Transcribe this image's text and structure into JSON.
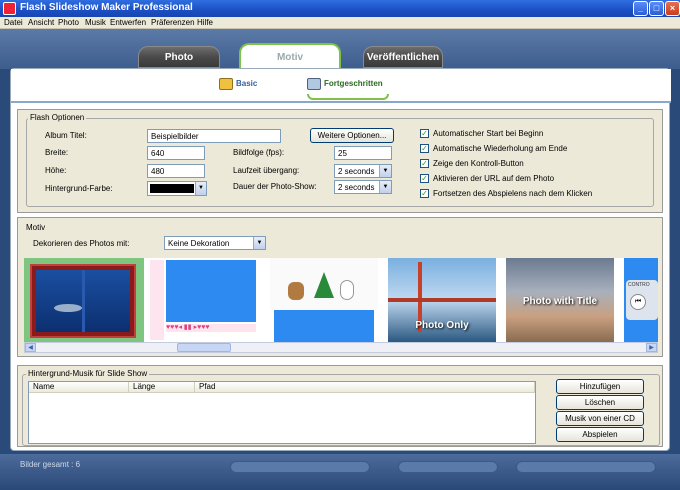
{
  "window": {
    "title": "Flash Slideshow Maker Professional"
  },
  "menu": [
    "Datei",
    "Ansicht",
    "Photo",
    "Musik",
    "Entwerfen",
    "Präferenzen",
    "Hilfe"
  ],
  "tabs": {
    "photo": "Photo",
    "motiv": "Motiv",
    "veroff": "Veröffentlichen"
  },
  "subtabs": {
    "basic": "Basic",
    "fort": "Fortgeschritten"
  },
  "flash": {
    "title": "Flash Optionen",
    "album_label": "Album Titel:",
    "album_value": "Beispielbilder",
    "more_button": "Weitere Optionen...",
    "width_label": "Breite:",
    "width_value": "640",
    "height_label": "Höhe:",
    "height_value": "480",
    "bgcolor_label": "Hintergrund-Farbe:",
    "bgcolor_value": "#000000",
    "fps_label": "Bildfolge (fps):",
    "fps_value": "25",
    "transition_label": "Laufzeit übergang:",
    "transition_value": "2 seconds",
    "duration_label": "Dauer der Photo-Show:",
    "duration_value": "2 seconds",
    "checks": [
      {
        "label": "Automatischer Start bei Beginn",
        "checked": true
      },
      {
        "label": "Automatische Wiederholung am Ende",
        "checked": true
      },
      {
        "label": "Zeige den Kontroll-Button",
        "checked": true
      },
      {
        "label": "Aktivieren der URL auf dem Photo",
        "checked": true
      },
      {
        "label": "Fortsetzen des Abspielens nach dem Klicken",
        "checked": true
      }
    ],
    "check_mark": "✓"
  },
  "motiv": {
    "title": "Motiv",
    "decorate_label": "Dekorieren des Photos mit:",
    "decorate_value": "Keine Dekoration",
    "thumbs": {
      "photo_only": "Photo Only",
      "photo_title": "Photo with Title",
      "control": "CONTRO"
    }
  },
  "music": {
    "title": "Hintergrund-Musik für Slide Show",
    "columns": [
      "Name",
      "Länge",
      "Pfad"
    ],
    "buttons": {
      "add": "Hinzufügen",
      "delete": "Löschen",
      "cd": "Musik von einer CD laden",
      "play": "Abspielen"
    }
  },
  "status": {
    "text": "Bilder gesamt : 6"
  }
}
